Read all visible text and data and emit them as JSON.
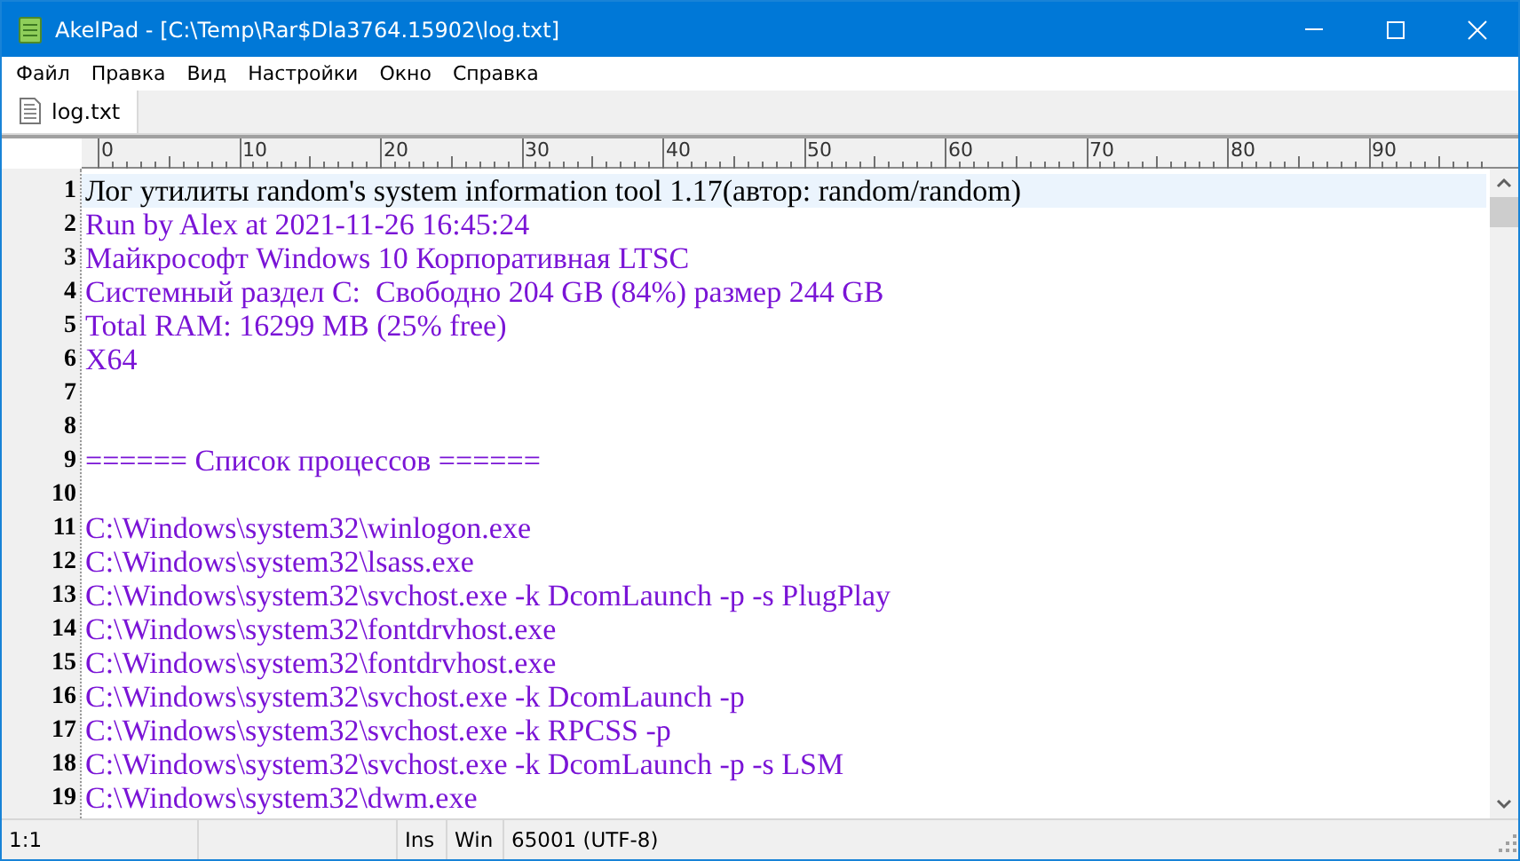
{
  "window": {
    "title": "AkelPad - [C:\\Temp\\Rar$Dla3764.15902\\log.txt]"
  },
  "menu": [
    "Файл",
    "Правка",
    "Вид",
    "Настройки",
    "Окно",
    "Справка"
  ],
  "tabs": [
    {
      "label": "log.txt",
      "selected": true
    }
  ],
  "ruler": {
    "labels": [
      "0",
      "10",
      "20",
      "30",
      "40",
      "50",
      "60",
      "70",
      "80",
      "90"
    ]
  },
  "lines": [
    {
      "number": "1",
      "text": "Лог утилиты random's system information tool 1.17(автор: random/random)",
      "current": true
    },
    {
      "number": "2",
      "text": "Run by Alex at 2021-11-26 16:45:24",
      "current": false
    },
    {
      "number": "3",
      "text": "Майкрософт Windows 10 Корпоративная LTSC",
      "current": false
    },
    {
      "number": "4",
      "text": "Системный раздел C:  Свободно 204 GB (84%) размер 244 GB",
      "current": false
    },
    {
      "number": "5",
      "text": "Total RAM: 16299 MB (25% free)",
      "current": false
    },
    {
      "number": "6",
      "text": "X64",
      "current": false
    },
    {
      "number": "7",
      "current": false
    },
    {
      "number": "8",
      "current": false
    },
    {
      "number": "9",
      "text": "====== Список процессов ======",
      "current": false
    },
    {
      "number": "10",
      "current": false
    },
    {
      "number": "11",
      "text": "C:\\Windows\\system32\\winlogon.exe",
      "current": false
    },
    {
      "number": "12",
      "text": "C:\\Windows\\system32\\lsass.exe",
      "current": false
    },
    {
      "number": "13",
      "text": "C:\\Windows\\system32\\svchost.exe -k DcomLaunch -p -s PlugPlay",
      "current": false
    },
    {
      "number": "14",
      "text": "C:\\Windows\\system32\\fontdrvhost.exe",
      "current": false
    },
    {
      "number": "15",
      "text": "C:\\Windows\\system32\\fontdrvhost.exe",
      "current": false
    },
    {
      "number": "16",
      "text": "C:\\Windows\\system32\\svchost.exe -k DcomLaunch -p",
      "current": false
    },
    {
      "number": "17",
      "text": "C:\\Windows\\system32\\svchost.exe -k RPCSS -p",
      "current": false
    },
    {
      "number": "18",
      "text": "C:\\Windows\\system32\\svchost.exe -k DcomLaunch -p -s LSM",
      "current": false
    },
    {
      "number": "19",
      "text": "C:\\Windows\\system32\\dwm.exe",
      "current": false
    }
  ],
  "status_bar": {
    "position": "1:1",
    "insert_mode": "Ins",
    "line_ending": "Win",
    "encoding": "65001 (UTF-8)"
  }
}
